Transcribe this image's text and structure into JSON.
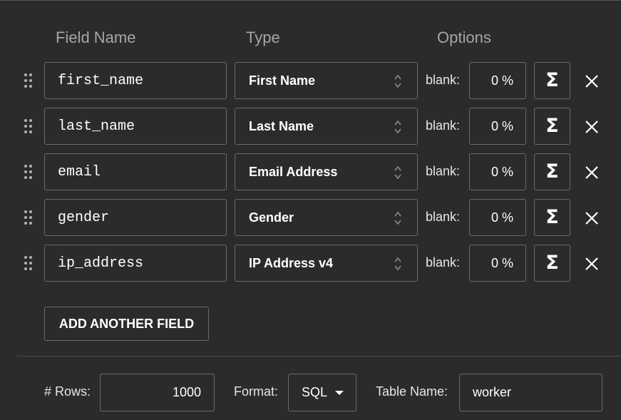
{
  "headers": {
    "field_name": "Field Name",
    "type": "Type",
    "options": "Options"
  },
  "fields": [
    {
      "name": "first_name",
      "type": "First Name",
      "blank_label": "blank:",
      "blank_value": "0 %"
    },
    {
      "name": "last_name",
      "type": "Last Name",
      "blank_label": "blank:",
      "blank_value": "0 %"
    },
    {
      "name": "email",
      "type": "Email Address",
      "blank_label": "blank:",
      "blank_value": "0 %"
    },
    {
      "name": "gender",
      "type": "Gender",
      "blank_label": "blank:",
      "blank_value": "0 %"
    },
    {
      "name": "ip_address",
      "type": "IP Address v4",
      "blank_label": "blank:",
      "blank_value": "0 %"
    }
  ],
  "formula_symbol": "Σ",
  "add_button": "ADD ANOTHER FIELD",
  "footer": {
    "rows_label": "# Rows:",
    "rows_value": "1000",
    "format_label": "Format:",
    "format_value": "SQL",
    "table_name_label": "Table Name:",
    "table_name_value": "worker"
  },
  "icons": {
    "drag": "drag-handle-icon",
    "type_select": "up-down-arrows-icon",
    "formula": "sigma-icon",
    "remove": "close-icon",
    "format_dropdown": "caret-down-icon"
  },
  "colors": {
    "background": "#2b2b2b",
    "border": "#6b6b6b",
    "header_text": "#a6a6a6",
    "text": "#ffffff"
  }
}
